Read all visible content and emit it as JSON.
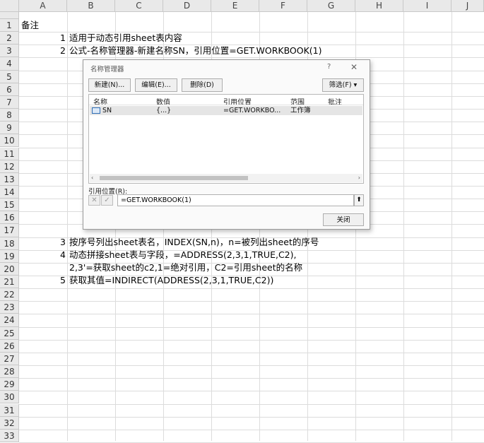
{
  "columns": [
    "A",
    "B",
    "C",
    "D",
    "E",
    "F",
    "G",
    "H",
    "I",
    "J"
  ],
  "rows": [
    "1",
    "2",
    "3",
    "4",
    "5",
    "6",
    "7",
    "8",
    "9",
    "10",
    "11",
    "12",
    "13",
    "14",
    "15",
    "16",
    "17",
    "18",
    "19",
    "20",
    "21",
    "22",
    "23",
    "24",
    "25",
    "26",
    "27",
    "28",
    "29",
    "30",
    "31",
    "32",
    "33"
  ],
  "cells": {
    "a1": "备注",
    "a2_num": "1",
    "b2": "适用于动态引用sheet表内容",
    "a3_num": "2",
    "b3": "公式-名称管理器-新建名称SN，引用位置=GET.WORKBOOK(1)",
    "a18_num": "3",
    "b18": "按序号列出sheet表名，INDEX(SN,n)，n=被列出sheet的序号",
    "a19_num": "4",
    "b19": "动态拼接sheet表与字段，=ADDRESS(2,3,1,TRUE,C2),",
    "b20": "2,3'=获取sheet的c2,1=绝对引用，C2=引用sheet的名称",
    "a21_num": "5",
    "b21": "获取其值=INDIRECT(ADDRESS(2,3,1,TRUE,C2))"
  },
  "dialog": {
    "title": "名称管理器",
    "help": "?",
    "close": "✕",
    "new_label": "新建(N)...",
    "edit_label": "编辑(E)...",
    "delete_label": "删除(D)",
    "filter_label": "筛选(F) ▾",
    "headers": [
      "名称",
      "数值",
      "引用位置",
      "范围",
      "批注"
    ],
    "entry": {
      "name": "SN",
      "value": "{...}",
      "refers_to": "=GET.WORKBO...",
      "scope": "工作簿"
    },
    "refers_label": "引用位置(R):",
    "refers_value": "=GET.WORKBOOK(1)",
    "close_button": "关闭"
  }
}
